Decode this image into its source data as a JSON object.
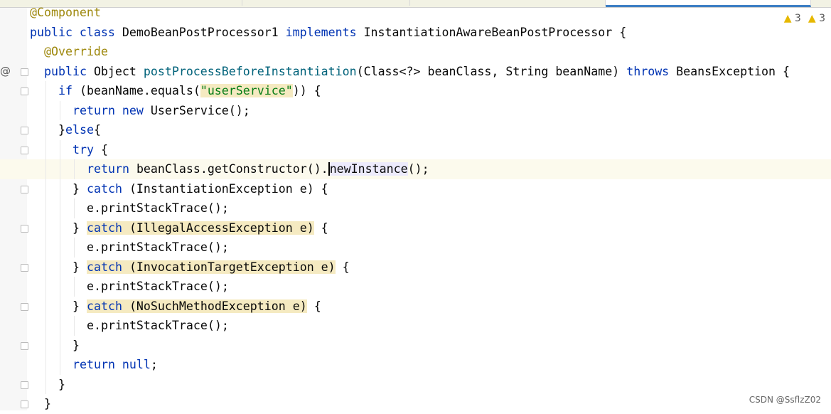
{
  "editor": {
    "warnings": [
      {
        "icon": "warning-icon",
        "count": "3"
      },
      {
        "icon": "warning-icon",
        "count": "3"
      }
    ],
    "current_line": 8,
    "lines": [
      {
        "indent": 0,
        "tokens": [
          [
            "an",
            "@Component"
          ]
        ]
      },
      {
        "indent": 0,
        "tokens": [
          [
            "kw",
            "public class "
          ],
          [
            "pl",
            "DemoBeanPostProcessor1 "
          ],
          [
            "kw",
            "implements "
          ],
          [
            "pl",
            "InstantiationAwareBeanPostProcessor {"
          ]
        ]
      },
      {
        "indent": 1,
        "tokens": [
          [
            "an",
            "@Override"
          ]
        ]
      },
      {
        "indent": 1,
        "gutter": "@",
        "fold": true,
        "tokens": [
          [
            "kw",
            "public "
          ],
          [
            "pl",
            "Object "
          ],
          [
            "md",
            "postProcessBeforeInstantiation"
          ],
          [
            "pl",
            "(Class<?> beanClass, String beanName) "
          ],
          [
            "kw",
            "throws "
          ],
          [
            "pl",
            "BeansException {"
          ]
        ]
      },
      {
        "indent": 2,
        "fold": true,
        "tokens": [
          [
            "kw",
            "if "
          ],
          [
            "pl",
            "(beanName.equals("
          ],
          [
            "st hl",
            "\"userService\""
          ],
          [
            "pl",
            ")) {"
          ]
        ]
      },
      {
        "indent": 3,
        "tokens": [
          [
            "kw",
            "return new "
          ],
          [
            "pl",
            "UserService();"
          ]
        ]
      },
      {
        "indent": 2,
        "fold": true,
        "tokens": [
          [
            "pl",
            "}"
          ],
          [
            "kw",
            "else"
          ],
          [
            "pl",
            "{"
          ]
        ]
      },
      {
        "indent": 3,
        "fold": true,
        "tokens": [
          [
            "kw",
            "try "
          ],
          [
            "pl",
            "{"
          ]
        ]
      },
      {
        "indent": 4,
        "tokens": [
          [
            "kw",
            "return "
          ],
          [
            "pl",
            "beanClass.getConstructor()."
          ],
          [
            "pl hv caret",
            "newInstance"
          ],
          [
            "pl",
            "();"
          ]
        ]
      },
      {
        "indent": 3,
        "fold": true,
        "tokens": [
          [
            "pl",
            "} "
          ],
          [
            "kw",
            "catch "
          ],
          [
            "pl",
            "(InstantiationException e) {"
          ]
        ]
      },
      {
        "indent": 4,
        "tokens": [
          [
            "pl",
            "e.printStackTrace();"
          ]
        ]
      },
      {
        "indent": 3,
        "fold": true,
        "tokens": [
          [
            "pl",
            "} "
          ],
          [
            "kw hl",
            "catch "
          ],
          [
            "pl hl",
            "(IllegalAccessException e)"
          ],
          [
            "pl",
            " {"
          ]
        ]
      },
      {
        "indent": 4,
        "tokens": [
          [
            "pl",
            "e.printStackTrace();"
          ]
        ]
      },
      {
        "indent": 3,
        "fold": true,
        "tokens": [
          [
            "pl",
            "} "
          ],
          [
            "kw hl",
            "catch "
          ],
          [
            "pl hl",
            "(InvocationTargetException e)"
          ],
          [
            "pl",
            " {"
          ]
        ]
      },
      {
        "indent": 4,
        "tokens": [
          [
            "pl",
            "e.printStackTrace();"
          ]
        ]
      },
      {
        "indent": 3,
        "fold": true,
        "tokens": [
          [
            "pl",
            "} "
          ],
          [
            "kw hl",
            "catch "
          ],
          [
            "pl hl",
            "(NoSuchMethodException e)"
          ],
          [
            "pl",
            " {"
          ]
        ]
      },
      {
        "indent": 4,
        "tokens": [
          [
            "pl",
            "e.printStackTrace();"
          ]
        ]
      },
      {
        "indent": 3,
        "fold": true,
        "tokens": [
          [
            "pl",
            "}"
          ]
        ]
      },
      {
        "indent": 3,
        "tokens": [
          [
            "kw",
            "return null"
          ],
          [
            "pl",
            ";"
          ]
        ]
      },
      {
        "indent": 2,
        "fold": true,
        "tokens": [
          [
            "pl",
            "}"
          ]
        ]
      },
      {
        "indent": 1,
        "fold": true,
        "tokens": [
          [
            "pl",
            "}"
          ]
        ]
      }
    ]
  },
  "watermark": "CSDN @SsflzZ02"
}
